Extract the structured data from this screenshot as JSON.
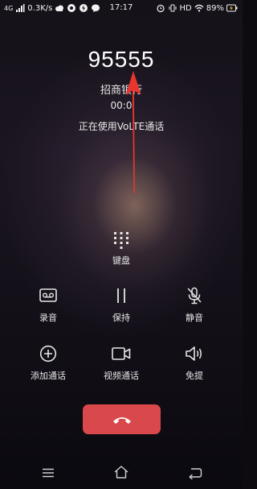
{
  "status_bar": {
    "network": "4G",
    "speed": "0.3K/s",
    "time": "17:17",
    "hd": "HD",
    "battery": "89%"
  },
  "call": {
    "number": "95555",
    "caller_name": "招商银行",
    "timer": "00:0",
    "volte_text": "正在使用VoLTE通话"
  },
  "keypad": {
    "label": "键盘"
  },
  "controls": {
    "record": "录音",
    "hold": "保持",
    "mute": "静音",
    "add_call": "添加通话",
    "video_call": "视频通话",
    "speaker": "免提"
  },
  "colors": {
    "end_call": "#d9484a",
    "arrow": "#e8352e"
  },
  "icons": {
    "record": "cassette-icon",
    "hold": "pause-icon",
    "mute": "mic-off-icon",
    "add_call": "plus-circle-icon",
    "video_call": "video-camera-icon",
    "speaker": "speaker-icon",
    "end_call": "phone-hangup-icon"
  }
}
